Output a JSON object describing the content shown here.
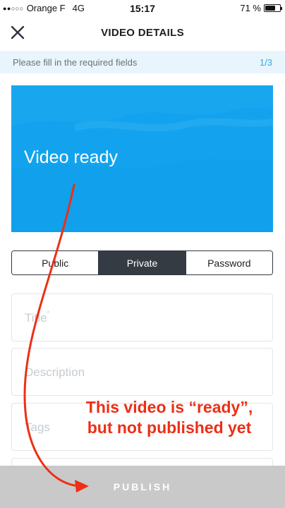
{
  "status_bar": {
    "signal_dots": "●●○○○",
    "carrier": "Orange F",
    "network": "4G",
    "time": "15:17",
    "battery_text": "71 %",
    "battery_level": 0.71
  },
  "header": {
    "title": "VIDEO DETAILS",
    "close_icon": "close-icon"
  },
  "banner": {
    "text": "Please fill in the required fields",
    "step": "1/3"
  },
  "video_preview": {
    "status_text": "Video ready",
    "color": "#13a3ee"
  },
  "visibility": {
    "options": [
      "Public",
      "Private",
      "Password"
    ],
    "selected": "Private"
  },
  "form": {
    "title_placeholder": "Title",
    "required_mark": "*",
    "description_placeholder": "Description",
    "tags_placeholder": "Tags"
  },
  "publish": {
    "label": "PUBLISH",
    "bar_color": "#c9c9c9"
  },
  "annotation": {
    "line1": "This video is “ready”,",
    "line2": "but not published yet",
    "color": "#ec2f16"
  }
}
